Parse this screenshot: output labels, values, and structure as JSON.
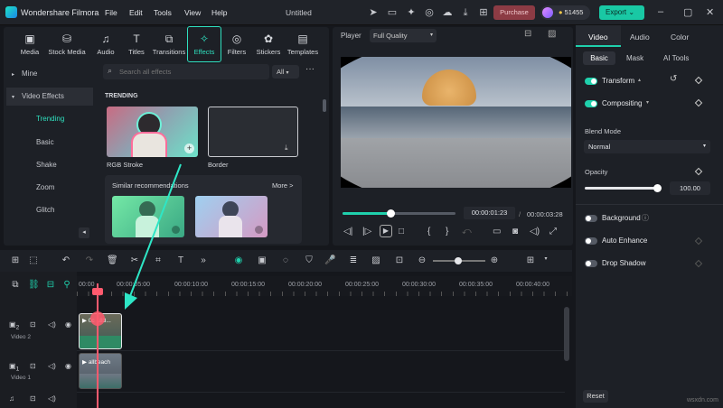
{
  "app": {
    "name": "Wondershare Filmora",
    "doc_title": "Untitled"
  },
  "menu": [
    "File",
    "Edit",
    "Tools",
    "View",
    "Help"
  ],
  "header": {
    "purchase": "Purchase",
    "credits": "51455",
    "export": "Export"
  },
  "media_tabs": [
    {
      "label": "Media",
      "icon": "folder-icon"
    },
    {
      "label": "Stock Media",
      "icon": "stock-icon"
    },
    {
      "label": "Audio",
      "icon": "music-note-icon"
    },
    {
      "label": "Titles",
      "icon": "title-t-icon"
    },
    {
      "label": "Transitions",
      "icon": "transition-icon"
    },
    {
      "label": "Effects",
      "icon": "effects-icon"
    },
    {
      "label": "Filters",
      "icon": "filter-icon"
    },
    {
      "label": "Stickers",
      "icon": "sticker-icon"
    },
    {
      "label": "Templates",
      "icon": "template-icon"
    }
  ],
  "sidebar": {
    "items": [
      "Mine",
      "Video Effects",
      "Trending",
      "Basic",
      "Shake",
      "Zoom",
      "Glitch"
    ]
  },
  "effects": {
    "search_placeholder": "Search all effects",
    "filter": "All",
    "section": "TRENDING",
    "items": [
      {
        "label": "RGB Stroke"
      },
      {
        "label": "Border"
      }
    ],
    "similar_title": "Similar recommendations",
    "more": "More >"
  },
  "player": {
    "label": "Player",
    "quality": "Full Quality",
    "current_time": "00:00:01:23",
    "total_time": "00:00:03:28",
    "progress": 0.42
  },
  "inspector": {
    "tabs": [
      "Video",
      "Audio",
      "Color"
    ],
    "subtabs": [
      "Basic",
      "Mask",
      "AI Tools"
    ],
    "transform": "Transform",
    "compositing": "Compositing",
    "blend_mode_label": "Blend Mode",
    "blend_mode": "Normal",
    "opacity_label": "Opacity",
    "opacity": "100.00",
    "background": "Background",
    "auto_enhance": "Auto Enhance",
    "drop_shadow": "Drop Shadow",
    "reset": "Reset"
  },
  "timeline": {
    "ticks": [
      "00:00",
      "00:00:05:00",
      "00:00:10:00",
      "00:00:15:00",
      "00:00:20:00",
      "00:00:25:00",
      "00:00:30:00",
      "00:00:35:00",
      "00:00:40:00"
    ],
    "tracks": [
      {
        "label": "Video 2",
        "num": "2"
      },
      {
        "label": "Video 1",
        "num": "1"
      }
    ],
    "clip_top": "0c 183...",
    "clip_bottom": "allbeach"
  },
  "colors": {
    "accent": "#1fd0ac",
    "purchase": "#8c3b44",
    "playhead": "#ff5a6e"
  },
  "watermark": "wsxdn.com"
}
